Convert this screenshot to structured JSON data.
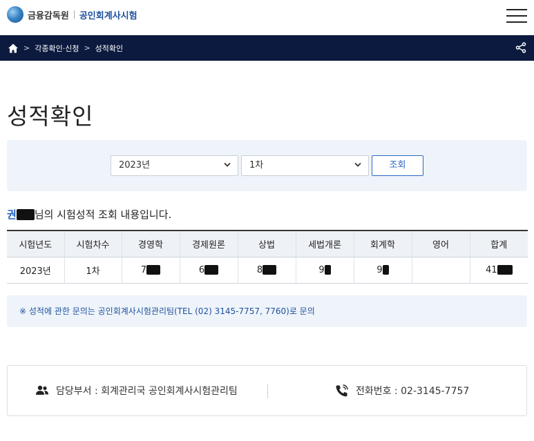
{
  "header": {
    "org_name": "금융감독원",
    "service_name": "공인회계사시험",
    "menu_icon": "hamburger-menu-icon"
  },
  "breadcrumb": {
    "home_icon": "home-icon",
    "items": [
      "각종확인·신청",
      "성적확인"
    ],
    "separator": ">",
    "share_icon": "share-icon"
  },
  "page": {
    "title": "성적확인"
  },
  "search": {
    "year_selected": "2023년",
    "round_selected": "1차",
    "submit_label": "조회"
  },
  "result": {
    "name_visible": "권",
    "message": "님의 시험성적 조회 내용입니다."
  },
  "table": {
    "headers": [
      "시험년도",
      "시험차수",
      "경영학",
      "경제원론",
      "상법",
      "세법개론",
      "회계학",
      "영어",
      "합계"
    ],
    "row": {
      "year": "2023년",
      "round": "1차",
      "scores": [
        "7",
        "6",
        "8",
        "9",
        "9",
        "",
        "41"
      ]
    }
  },
  "notice": {
    "text": "※ 성적에 관한 문의는 공인회계사시험관리팀(TEL (02) 3145-7757, 7760)로 문의"
  },
  "contact": {
    "dept_icon": "people-icon",
    "dept_text": "담당부서 : 회계관리국 공인회계사시험관리팀",
    "phone_icon": "phone-icon",
    "phone_text": "전화번호 : 02-3145-7757"
  },
  "colors": {
    "navbar": "#0b1a3e",
    "accent_blue": "#2b66c4",
    "panel_bg": "#eef4fa"
  }
}
